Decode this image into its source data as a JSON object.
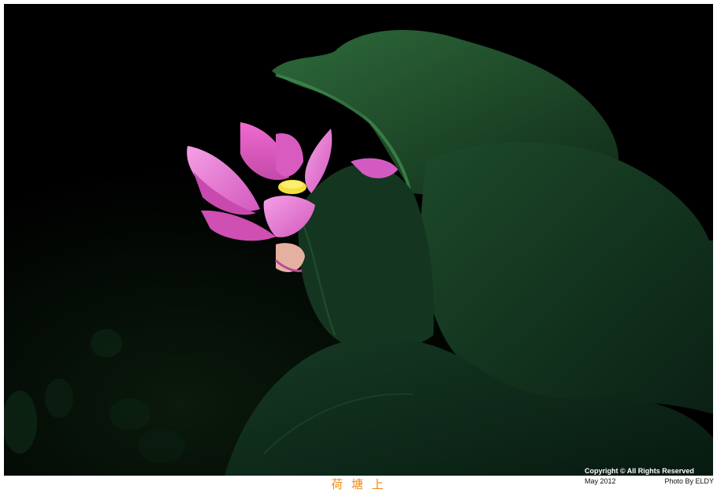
{
  "photo": {
    "subject": "lotus-flower-with-leaves",
    "colors": {
      "background": "#000000",
      "petal": "#e86fc8",
      "stamen": "#f2e03a",
      "leaf": "#1f4a2c"
    }
  },
  "caption": "荷 塘 上",
  "watermark": {
    "copyright": "Copyright © All Rights Reserved",
    "date": "May 2012",
    "credit": "Photo By ELDY"
  }
}
